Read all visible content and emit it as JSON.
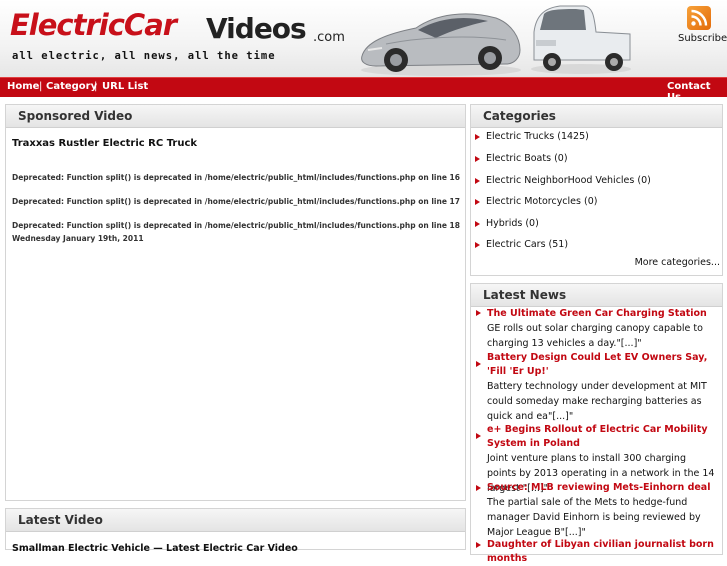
{
  "header": {
    "logo_main": "ElectricCar",
    "logo_videos": "Videos",
    "logo_com": ".com",
    "tagline": "all electric, all news, all the time",
    "subscribe_label": "Subscribe",
    "rss_icon": "rss-icon"
  },
  "nav": {
    "home": "Home",
    "category": "Category",
    "url_list": "URL List",
    "contact": "Contact Us",
    "separator": "|"
  },
  "sponsored": {
    "title": "Sponsored Video",
    "video_title": "Traxxas Rustler Electric RC Truck",
    "deprecated": [
      "Deprecated: Function split() is deprecated in /home/electric/public_html/includes/functions.php on line 16",
      "Deprecated: Function split() is deprecated in /home/electric/public_html/includes/functions.php on line 17",
      "Deprecated: Function split() is deprecated in /home/electric/public_html/includes/functions.php on line 18"
    ],
    "date": "Wednesday January 19th, 2011"
  },
  "latest_video": {
    "title": "Latest Video",
    "text": "Smallman Electric Vehicle — Latest Electric Car Video"
  },
  "categories": {
    "title": "Categories",
    "items": [
      {
        "label": "Electric Trucks (1425)"
      },
      {
        "label": "Electric Boats (0)"
      },
      {
        "label": "Electric NeighborHood Vehicles (0)"
      },
      {
        "label": "Electric Motorcycles (0)"
      },
      {
        "label": "Hybrids (0)"
      },
      {
        "label": "Electric Cars (51)"
      }
    ],
    "more": "More categories..."
  },
  "latest_news": {
    "title": "Latest News",
    "items": [
      {
        "title": "The Ultimate Green Car Charging Station",
        "summary": "GE rolls out solar charging canopy capable to charging 13 vehicles a day.\"[...]\""
      },
      {
        "title": "Battery Design Could Let EV Owners Say, 'Fill 'Er Up!'",
        "summary": "Battery technology under development at MIT could someday make recharging batteries as quick and ea\"[...]\""
      },
      {
        "title": "e+ Begins Rollout of Electric Car Mobility System in Poland",
        "summary": "Joint venture plans to install 300 charging points by 2013 operating in a network in the 14 largest \"[...]\""
      },
      {
        "title": "Source: MLB reviewing Mets-Einhorn deal",
        "summary": "The partial sale of the Mets to hedge-fund manager David Einhorn is being reviewed by Major League B\"[...]\""
      },
      {
        "title": "Daughter of Libyan civilian journalist born months",
        "summary": ""
      }
    ]
  }
}
